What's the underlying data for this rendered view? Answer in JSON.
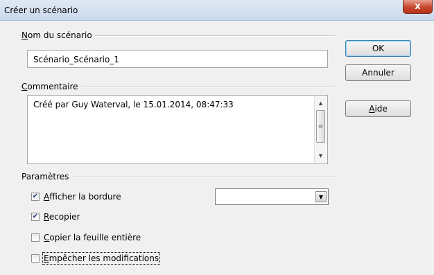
{
  "window": {
    "title": "Créer un scénario",
    "close_glyph": "x"
  },
  "name_section": {
    "label_underlined": "N",
    "label_rest": "om du scénario",
    "value": "Scénario_Scénario_1"
  },
  "comment_section": {
    "label_underlined": "C",
    "label_rest": "ommentaire",
    "value": "Créé par Guy Waterval, le 15.01.2014, 08:47:33"
  },
  "params_section": {
    "label": "Paramètres",
    "options": [
      {
        "underlined": "A",
        "rest": "fficher la bordure",
        "checked": true
      },
      {
        "underlined": "R",
        "rest": "ecopier",
        "checked": true
      },
      {
        "underlined": "C",
        "rest": "opier la feuille entière",
        "checked": false
      },
      {
        "underlined": "E",
        "rest": "mpêcher les modifications",
        "checked": false
      }
    ],
    "border_color_value": ""
  },
  "buttons": {
    "ok": "OK",
    "cancel": "Annuler",
    "help_underlined": "A",
    "help_rest": "ide"
  },
  "icons": {
    "check": "✔",
    "scroll_up": "▲",
    "scroll_down": "▼",
    "thumb_grip": "≡",
    "combo_arrow": "▼"
  }
}
